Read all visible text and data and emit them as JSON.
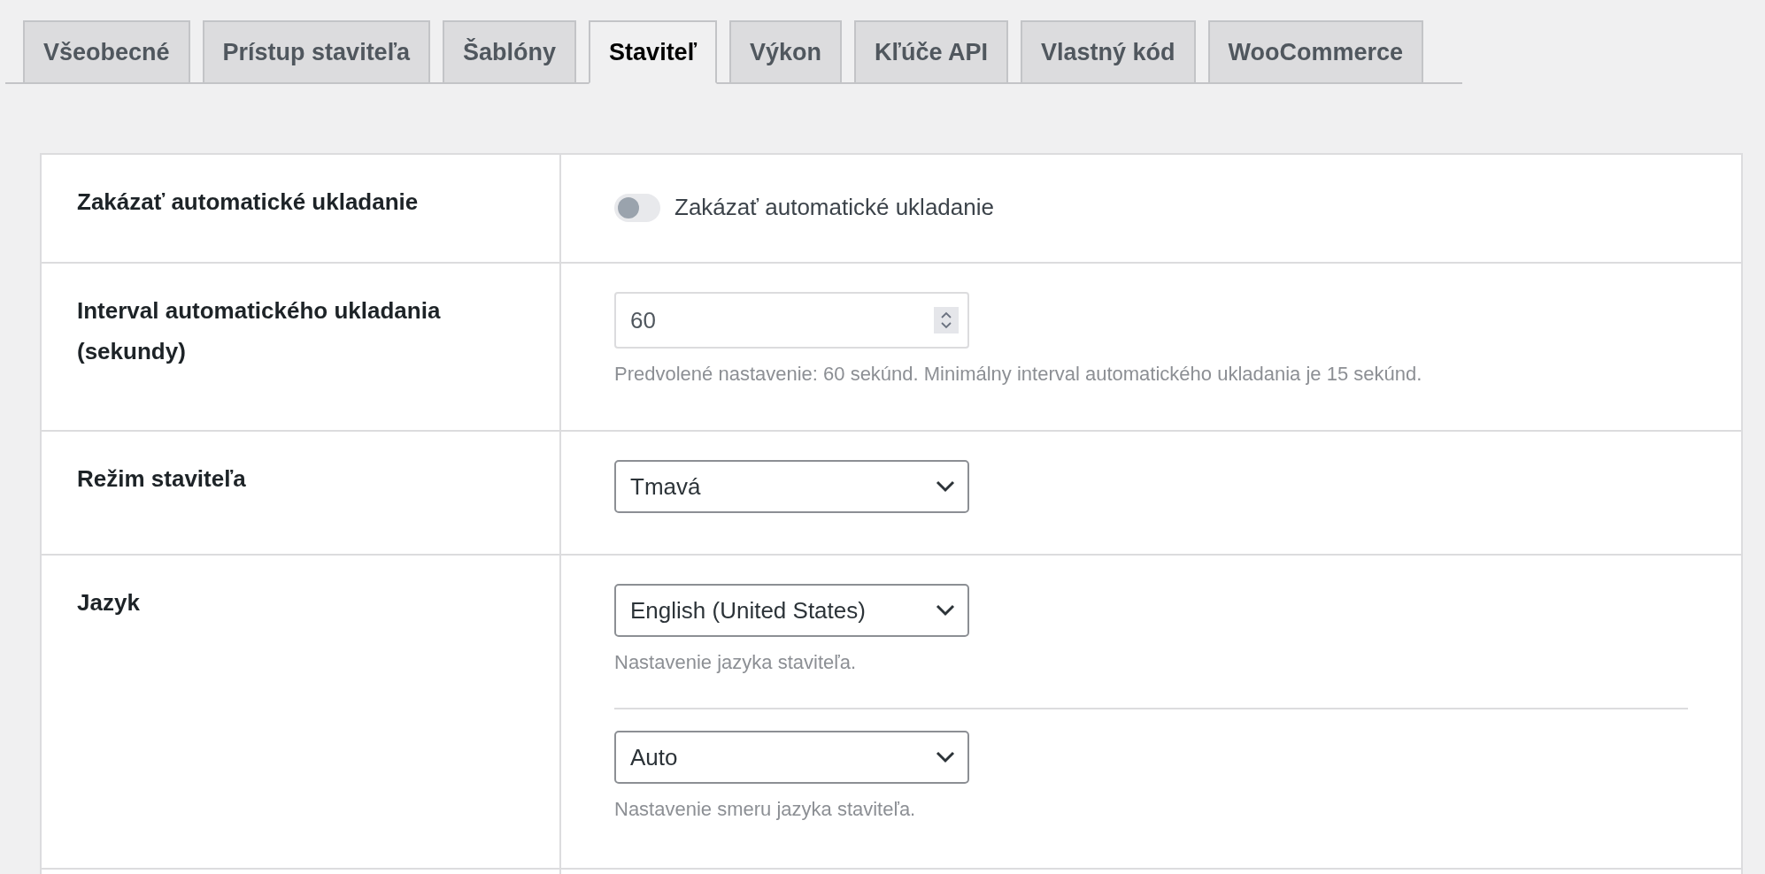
{
  "tabs": [
    {
      "label": "Všeobecné",
      "selected": false
    },
    {
      "label": "Prístup staviteľa",
      "selected": false
    },
    {
      "label": "Šablóny",
      "selected": false
    },
    {
      "label": "Staviteľ",
      "selected": true
    },
    {
      "label": "Výkon",
      "selected": false
    },
    {
      "label": "Kľúče API",
      "selected": false
    },
    {
      "label": "Vlastný kód",
      "selected": false
    },
    {
      "label": "WooCommerce",
      "selected": false
    }
  ],
  "settings": [
    {
      "label": "Zakázať automatické ukladanie",
      "controls": [
        {
          "kind": "toggle",
          "label": "Zakázať automatické ukladanie",
          "on": false
        }
      ]
    },
    {
      "label": "Interval automatického ukladania (sekundy)",
      "controls": [
        {
          "kind": "number",
          "value": "60",
          "help": "Predvolené nastavenie: 60 sekúnd. Minimálny interval automatického ukladania je 15 sekúnd."
        }
      ]
    },
    {
      "label": "Režim staviteľa",
      "controls": [
        {
          "kind": "select",
          "value": "Tmavá"
        }
      ]
    },
    {
      "label": "Jazyk",
      "controls": [
        {
          "kind": "select",
          "value": "English (United States)",
          "help": "Nastavenie jazyka staviteľa."
        },
        {
          "kind": "select",
          "value": "Auto",
          "help": "Nastavenie smeru jazyka staviteľa."
        }
      ]
    }
  ]
}
